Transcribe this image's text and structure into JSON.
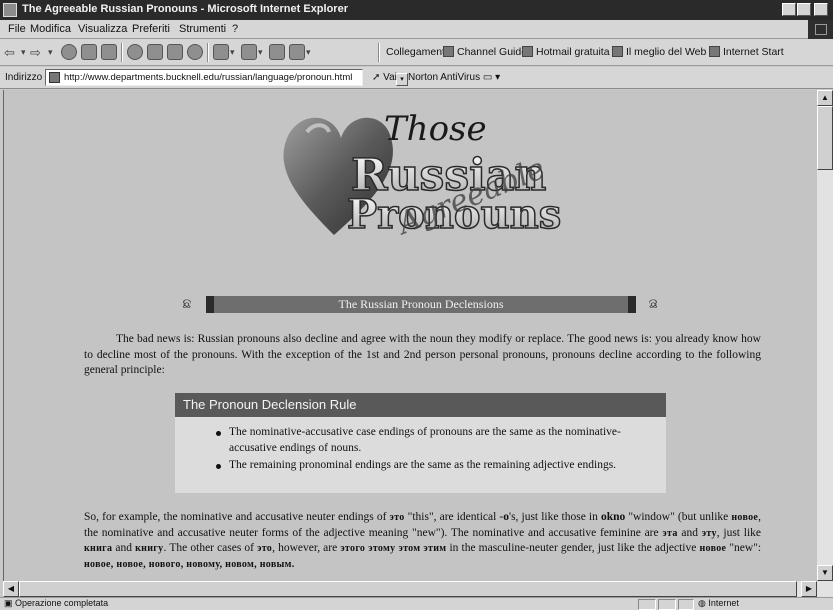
{
  "window": {
    "title": "The Agreeable Russian Pronouns - Microsoft Internet Explorer",
    "buttons": {
      "minimize": "_",
      "maximize": "□",
      "close": "×"
    }
  },
  "menu": {
    "items": [
      "File",
      "Modifica",
      "Visualizza",
      "Preferiti",
      "Strumenti",
      "?"
    ]
  },
  "toolbar": {
    "back_arrow": "⇦",
    "forward_arrow": "⇨",
    "dropdown_glyph": "▾",
    "links_label": "Collegamenti",
    "links": [
      "Channel Guide",
      "Hotmail gratuita",
      "Il meglio del Web",
      "Internet Start"
    ],
    "icons": [
      "stop-icon",
      "refresh-icon",
      "home-icon",
      "search-icon",
      "favorites-icon",
      "history-icon",
      "channels-icon",
      "mail-icon",
      "print-icon",
      "edit-icon",
      "discuss-icon"
    ]
  },
  "address": {
    "label": "Indirizzo",
    "url": "http://www.departments.bucknell.edu/russian/language/pronoun.html",
    "go": "Vai",
    "norton": "Norton AntiVirus"
  },
  "page": {
    "logo": {
      "line1": "Those",
      "line2": "Russian",
      "line3": "Pronouns",
      "script_word": "Agreeable"
    },
    "banner": {
      "title": "The Russian Pronoun Declensions",
      "left_ornament": "ଛ",
      "right_ornament": "ଛ"
    },
    "intro": "The bad news is: Russian pronouns also decline and agree with the noun they modify or replace. The good news is: you already know how to decline most of the pronouns. With the exception of the 1st and 2nd person personal pronouns, pronouns decline according to the following general principle:",
    "rule": {
      "title": "The Pronoun Declension Rule",
      "items": [
        "The nominative-accusative case endings of pronouns are the same as the nominative-accusative endings of nouns.",
        "The remaining pronominal endings are the same as the remaining adjective endings."
      ]
    },
    "example": {
      "p1": "So, for example, the nominative and accusative neuter endings of",
      "eto1": "это",
      "p2": "\"this\", are identical -",
      "o": "o",
      "p3": "'s, just like those in",
      "okno": "okno",
      "p4": "\"window\" (but unlike",
      "novoe1": "новое",
      "p5": ", the nominative and accusative neuter forms of the adjective meaning \"new\"). The nominative and accusative feminine are",
      "eta": "эта",
      "p6": "and",
      "etu": "эту",
      "p7": ", just like",
      "kniga": "книга",
      "p8": "and",
      "knigu": "книгу",
      "p9": ". The other cases of",
      "eto2": "это",
      "p10": ", however, are",
      "forms": "этого этому этом этим",
      "p11": "in the masculine-neuter gender, just like the adjective",
      "novoe2": "новое",
      "p12": "\"new\":",
      "adj_forms": "новое, новое, нового, новому, новом, новым."
    }
  },
  "scroll": {
    "up": "▲",
    "down": "▼",
    "left": "◀",
    "right": "▶"
  },
  "status": {
    "text": "Operazione completata",
    "zone": "Internet"
  },
  "colors": {
    "banner_bar": "#6e6e6e",
    "rule_header": "#595959",
    "page_bg": "#c4c4c4"
  }
}
